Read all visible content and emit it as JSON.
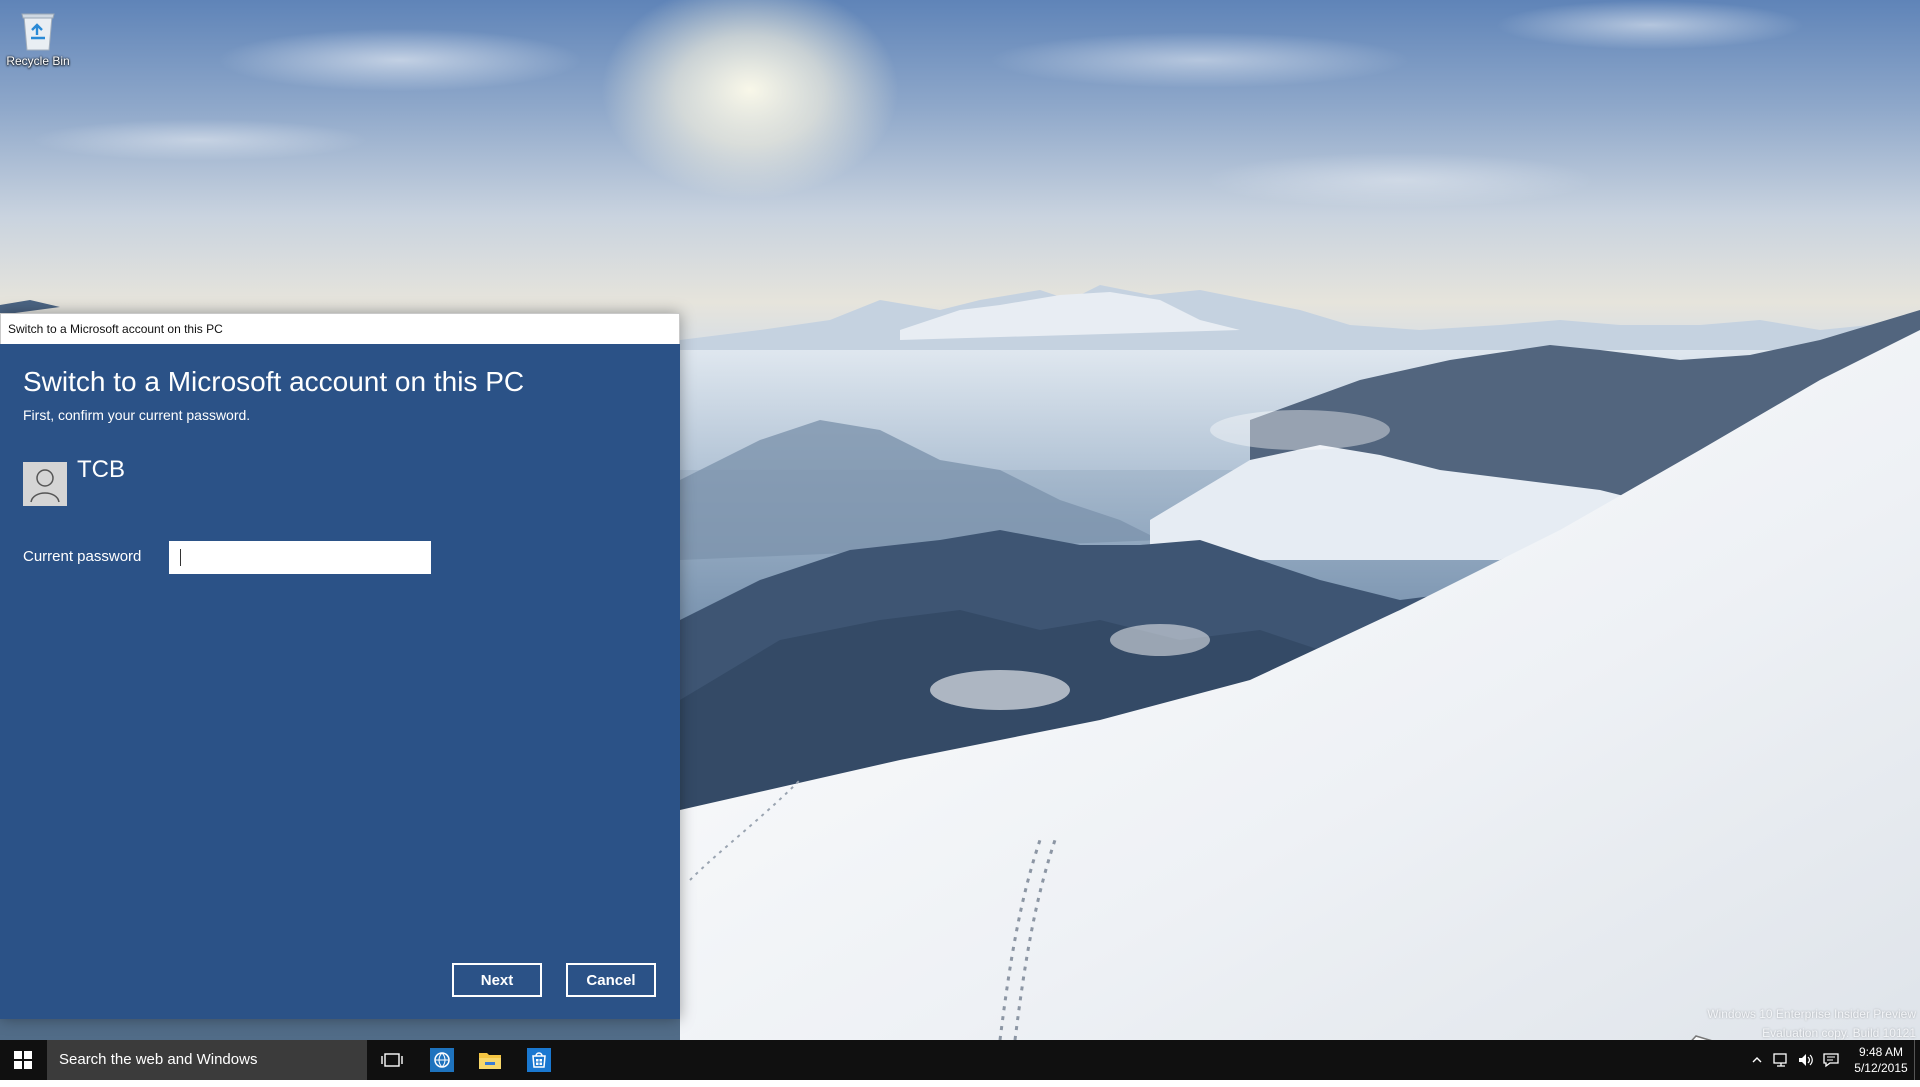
{
  "desktop": {
    "recycle_bin_label": "Recycle Bin",
    "watermark": {
      "line1": "Windows 10 Enterprise Insider Preview",
      "line2": "Evaluation copy. Build 10121"
    },
    "site_watermark": "The Collection Book"
  },
  "dialog": {
    "window_title": "Switch to a Microsoft account on this PC",
    "heading": "Switch to a Microsoft account on this PC",
    "subheading": "First, confirm your current password.",
    "username": "TCB",
    "password_label": "Current password",
    "password_value": "",
    "next_label": "Next",
    "cancel_label": "Cancel",
    "background_color": "#2b5287"
  },
  "taskbar": {
    "search_placeholder": "Search the web and Windows",
    "pinned_icons": [
      "task-view-icon",
      "internet-explorer-icon",
      "file-explorer-icon",
      "store-icon"
    ],
    "tray_icons": [
      "show-hidden-icons-chevron",
      "network-icon",
      "volume-icon",
      "action-center-icon"
    ],
    "time": "9:48 AM",
    "date": "5/12/2015"
  },
  "colors": {
    "taskbar": "#101010",
    "search_box": "#3b3b3b",
    "accent": "#2b5287"
  }
}
